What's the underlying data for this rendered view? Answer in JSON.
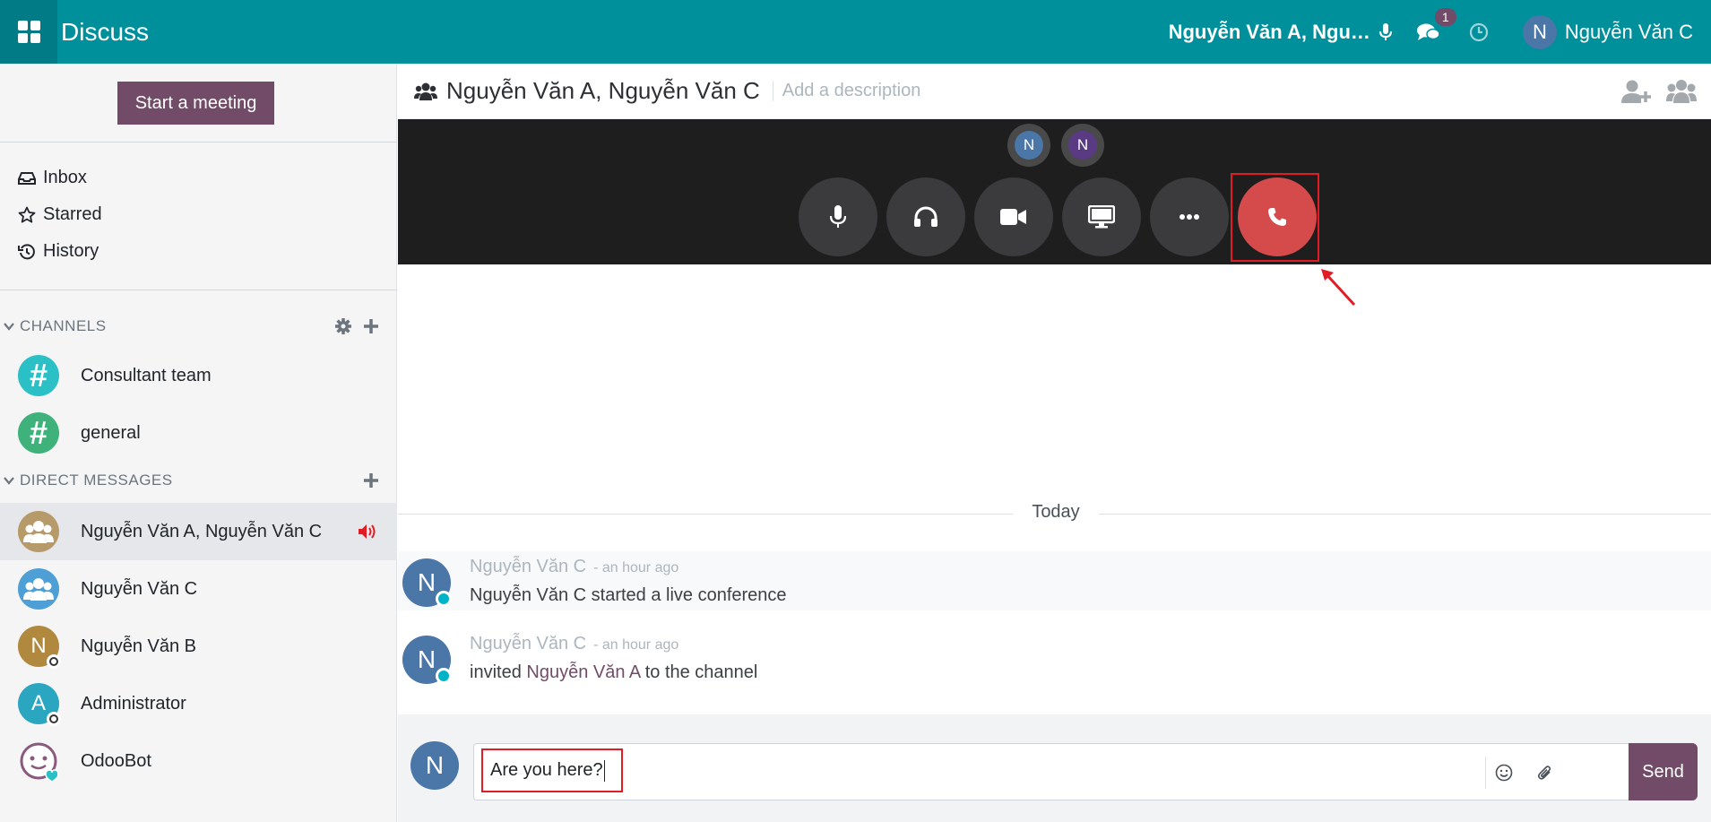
{
  "topbar": {
    "app_title": "Discuss",
    "call_name": "Nguyễn Văn A, Ngu…",
    "chat_badge": "1",
    "user_initial": "N",
    "user_name": "Nguyễn Văn C"
  },
  "sidebar": {
    "start_meeting": "Start a meeting",
    "nav": [
      {
        "label": "Inbox",
        "icon": "inbox-icon"
      },
      {
        "label": "Starred",
        "icon": "star-icon"
      },
      {
        "label": "History",
        "icon": "history-icon"
      }
    ],
    "channels_title": "CHANNELS",
    "channels": [
      {
        "label": "Consultant team",
        "color": "#2bc0c5"
      },
      {
        "label": "general",
        "color": "#3eb27a"
      }
    ],
    "dm_title": "DIRECT MESSAGES",
    "dms": [
      {
        "label": "Nguyễn Văn A, Nguyễn Văn C",
        "initial": ""
      },
      {
        "label": "Nguyễn Văn C",
        "initial": ""
      },
      {
        "label": "Nguyễn Văn B",
        "initial": "N"
      },
      {
        "label": "Administrator",
        "initial": "A"
      },
      {
        "label": "OdooBot",
        "initial": ""
      }
    ]
  },
  "header": {
    "title": "Nguyễn Văn A, Nguyễn Văn C",
    "description_placeholder": "Add a description"
  },
  "call": {
    "participants": [
      {
        "initial": "N",
        "color": "#4a76a8"
      },
      {
        "initial": "N",
        "color": "#5a3a82"
      }
    ]
  },
  "thread": {
    "date_label": "Today",
    "messages": [
      {
        "initial": "N",
        "author": "Nguyễn Văn C",
        "time": "- an hour ago",
        "body": "Nguyễn Văn C started a live conference"
      },
      {
        "initial": "N",
        "author": "Nguyễn Văn C",
        "time": "- an hour ago",
        "body_pre": "invited ",
        "mention": "Nguyễn Văn A",
        "body_post": " to the channel"
      }
    ]
  },
  "composer": {
    "initial": "N",
    "text": "Are you here?",
    "send_label": "Send"
  }
}
